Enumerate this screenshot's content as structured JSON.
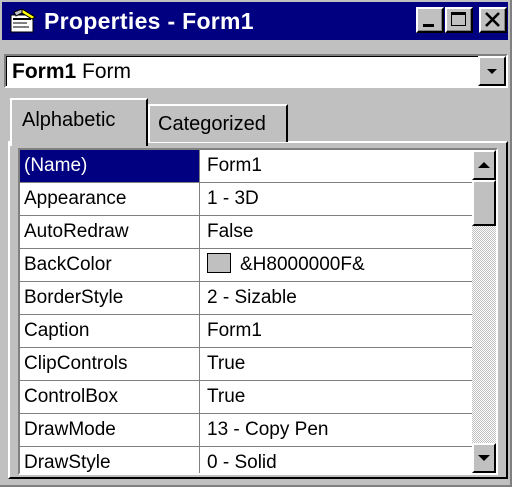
{
  "window": {
    "title": "Properties - Form1",
    "title_icon": "properties-window-icon",
    "controls": {
      "minimize_icon": "minimize-icon",
      "maximize_icon": "maximize-icon",
      "close_icon": "close-icon"
    }
  },
  "object_selector": {
    "name": "Form1",
    "type": "Form",
    "dropdown_icon": "chevron-down-icon"
  },
  "tabs": [
    {
      "label": "Alphabetic",
      "active": true
    },
    {
      "label": "Categorized",
      "active": false
    }
  ],
  "properties": [
    {
      "name": "(Name)",
      "value": "Form1",
      "selected": true
    },
    {
      "name": "Appearance",
      "value": "1 - 3D"
    },
    {
      "name": "AutoRedraw",
      "value": "False"
    },
    {
      "name": "BackColor",
      "value": "&H8000000F&",
      "swatch_color": "#c0c0c0"
    },
    {
      "name": "BorderStyle",
      "value": "2 - Sizable"
    },
    {
      "name": "Caption",
      "value": "Form1"
    },
    {
      "name": "ClipControls",
      "value": "True"
    },
    {
      "name": "ControlBox",
      "value": "True"
    },
    {
      "name": "DrawMode",
      "value": "13 - Copy Pen"
    },
    {
      "name": "DrawStyle",
      "value": "0 - Solid"
    }
  ],
  "colors": {
    "title_bar": "#000080",
    "selection": "#000080",
    "face": "#c0c0c0"
  }
}
